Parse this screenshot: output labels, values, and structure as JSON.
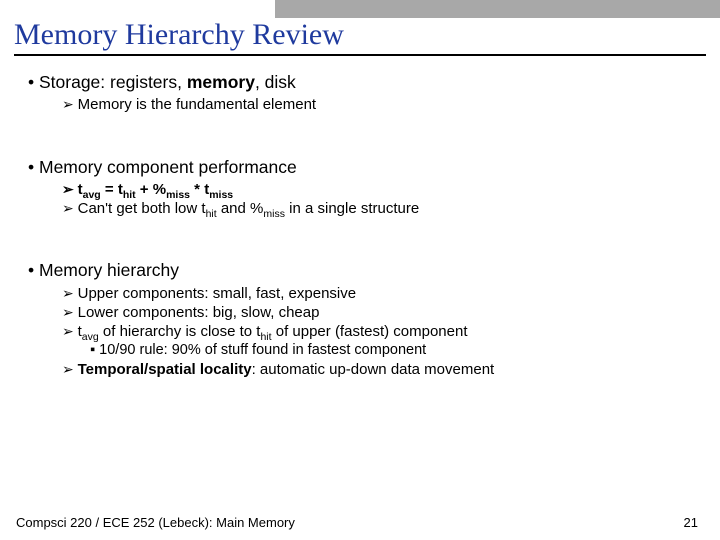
{
  "title": "Memory Hierarchy Review",
  "b1": {
    "pre": "Storage: registers, ",
    "bold": "memory",
    "post": ", disk"
  },
  "b1s1": "Memory is the fundamental element",
  "b2": "Memory component performance",
  "b2s1": {
    "avg": "avg",
    "eq": " = t",
    "hit": "hit",
    "plus": " + %",
    "miss": "miss",
    "times": " * t",
    "miss2": "miss",
    "t": "t"
  },
  "b2s2": {
    "pre": "Can't get both low t",
    "hit": "hit",
    "mid": " and %",
    "miss": "miss",
    "post": " in a single structure"
  },
  "b3": "Memory hierarchy",
  "b3s1": "Upper components: small, fast, expensive",
  "b3s2": "Lower components: big, slow, cheap",
  "b3s3": {
    "t": "t",
    "avg": "avg",
    "mid": " of hierarchy is close to t",
    "hit": "hit",
    "post": " of upper (fastest) component"
  },
  "b3s3a": "10/90 rule: 90% of stuff found in fastest component",
  "b3s4": {
    "bold": "Temporal/spatial locality",
    "post": ": automatic up-down data movement"
  },
  "footer_left": "Compsci 220 / ECE 252 (Lebeck): Main Memory",
  "footer_right": "21"
}
